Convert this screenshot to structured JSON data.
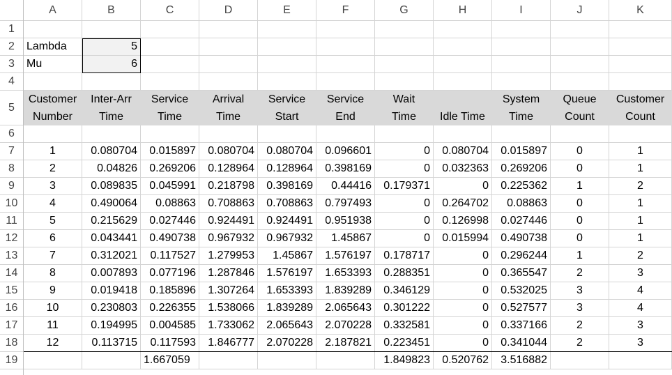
{
  "column_headers": [
    "A",
    "B",
    "C",
    "D",
    "E",
    "F",
    "G",
    "H",
    "I",
    "J",
    "K"
  ],
  "row_headers": [
    "1",
    "2",
    "3",
    "4",
    "5",
    "6",
    "7",
    "8",
    "9",
    "10",
    "11",
    "12",
    "13",
    "14",
    "15",
    "16",
    "17",
    "18",
    "19"
  ],
  "params": [
    {
      "label": "Lambda",
      "value": "5"
    },
    {
      "label": "Mu",
      "value": "6"
    }
  ],
  "table_headers": [
    {
      "line1": "Customer",
      "line2": "Number"
    },
    {
      "line1": "Inter-Arr",
      "line2": "Time"
    },
    {
      "line1": "Service",
      "line2": "Time"
    },
    {
      "line1": "Arrival",
      "line2": "Time"
    },
    {
      "line1": "Service",
      "line2": "Start"
    },
    {
      "line1": "Service",
      "line2": "End"
    },
    {
      "line1": "Wait",
      "line2": "Time"
    },
    {
      "line1": "",
      "line2": "Idle Time"
    },
    {
      "line1": "System",
      "line2": "Time"
    },
    {
      "line1": "Queue",
      "line2": "Count"
    },
    {
      "line1": "Customer",
      "line2": "Count"
    }
  ],
  "rows": [
    [
      "1",
      "0.080704",
      "0.015897",
      "0.080704",
      "0.080704",
      "0.096601",
      "0",
      "0.080704",
      "0.015897",
      "0",
      "1"
    ],
    [
      "2",
      "0.04826",
      "0.269206",
      "0.128964",
      "0.128964",
      "0.398169",
      "0",
      "0.032363",
      "0.269206",
      "0",
      "1"
    ],
    [
      "3",
      "0.089835",
      "0.045991",
      "0.218798",
      "0.398169",
      "0.44416",
      "0.179371",
      "0",
      "0.225362",
      "1",
      "2"
    ],
    [
      "4",
      "0.490064",
      "0.08863",
      "0.708863",
      "0.708863",
      "0.797493",
      "0",
      "0.264702",
      "0.08863",
      "0",
      "1"
    ],
    [
      "5",
      "0.215629",
      "0.027446",
      "0.924491",
      "0.924491",
      "0.951938",
      "0",
      "0.126998",
      "0.027446",
      "0",
      "1"
    ],
    [
      "6",
      "0.043441",
      "0.490738",
      "0.967932",
      "0.967932",
      "1.45867",
      "0",
      "0.015994",
      "0.490738",
      "0",
      "1"
    ],
    [
      "7",
      "0.312021",
      "0.117527",
      "1.279953",
      "1.45867",
      "1.576197",
      "0.178717",
      "0",
      "0.296244",
      "1",
      "2"
    ],
    [
      "8",
      "0.007893",
      "0.077196",
      "1.287846",
      "1.576197",
      "1.653393",
      "0.288351",
      "0",
      "0.365547",
      "2",
      "3"
    ],
    [
      "9",
      "0.019418",
      "0.185896",
      "1.307264",
      "1.653393",
      "1.839289",
      "0.346129",
      "0",
      "0.532025",
      "3",
      "4"
    ],
    [
      "10",
      "0.230803",
      "0.226355",
      "1.538066",
      "1.839289",
      "2.065643",
      "0.301222",
      "0",
      "0.527577",
      "3",
      "4"
    ],
    [
      "11",
      "0.194995",
      "0.004585",
      "1.733062",
      "2.065643",
      "2.070228",
      "0.332581",
      "0",
      "0.337166",
      "2",
      "3"
    ],
    [
      "12",
      "0.113715",
      "0.117593",
      "1.846777",
      "2.070228",
      "2.187821",
      "0.223451",
      "0",
      "0.341044",
      "2",
      "3"
    ]
  ],
  "totals": [
    "",
    "",
    "1.667059",
    "",
    "",
    "",
    "1.849823",
    "0.520762",
    "3.516882",
    "",
    ""
  ]
}
